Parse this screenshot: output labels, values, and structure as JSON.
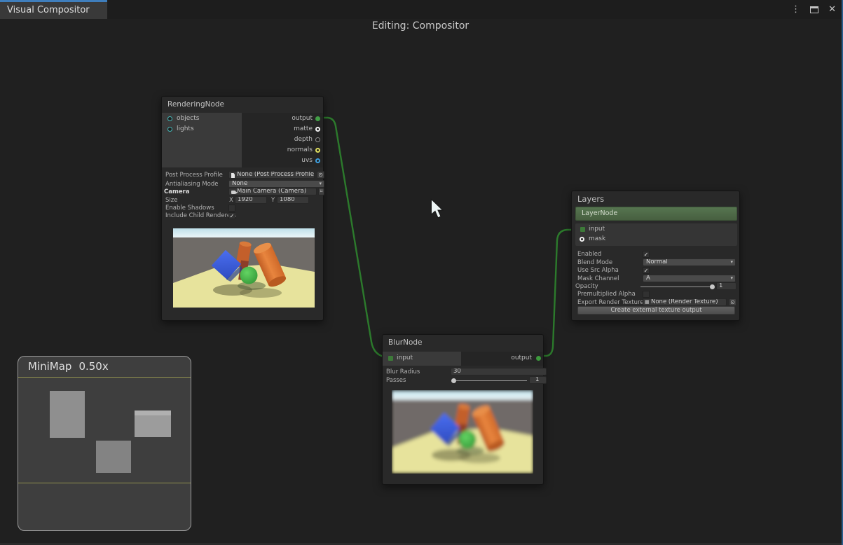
{
  "window": {
    "tab": "Visual Compositor",
    "editing": "Editing: Compositor",
    "menu_icon": "⋮",
    "close_icon": "✕"
  },
  "nodes": {
    "rendering": {
      "title": "RenderingNode",
      "in_objects": "objects",
      "in_lights": "lights",
      "out_output": "output",
      "out_matte": "matte",
      "out_depth": "depth",
      "out_normals": "normals",
      "out_uvs": "uvs",
      "post_process_label": "Post Process Profile",
      "post_process_value": "None (Post Process Profile)",
      "antialiasing_label": "Antialiasing Mode",
      "antialiasing_value": "None",
      "camera_label": "Camera",
      "camera_value": "Main Camera (Camera)",
      "size_label": "Size",
      "size_x_label": "X",
      "size_x": "1920",
      "size_y_label": "Y",
      "size_y": "1080",
      "enable_shadows_label": "Enable Shadows",
      "include_child_label": "Include Child Renderers"
    },
    "layers": {
      "title": "Layers",
      "layer_item": "LayerNode",
      "in_input": "input",
      "in_mask": "mask",
      "enabled_label": "Enabled",
      "blend_mode_label": "Blend Mode",
      "blend_mode_value": "Normal",
      "use_src_alpha_label": "Use Src Alpha",
      "mask_channel_label": "Mask Channel",
      "mask_channel_value": "A",
      "opacity_label": "Opacity",
      "opacity_value": "1",
      "premultiplied_label": "Premultiplied Alpha",
      "export_label": "Export Render Texture",
      "export_value": "None (Render Texture)",
      "export_icon": "▦",
      "create_button": "Create external texture output"
    },
    "blur": {
      "title": "BlurNode",
      "in_input": "input",
      "out_output": "output",
      "blur_radius_label": "Blur Radius",
      "blur_radius_value": "30",
      "passes_label": "Passes",
      "passes_value": "1"
    }
  },
  "minimap": {
    "title": "MiniMap",
    "zoom": "0.50x"
  },
  "glyphs": {
    "check": "✓",
    "dropdown_arrow": "▾",
    "picker": "⊙"
  },
  "colors": {
    "tab_accent_blue": "#3F7EBC",
    "wire_green": "#2C7A2C",
    "port_output_green": "#43A047",
    "port_dim_green": "#3D7A39",
    "port_teal": "#45B8B8",
    "port_yellow": "#DEDE60",
    "port_blue": "#3FA0E0",
    "port_white": "#F2F2F2",
    "port_gray": "#8F8F8F",
    "layer_item_green": "#4F6C48",
    "minimap_viewport_yellow": "#8F8F4E"
  }
}
